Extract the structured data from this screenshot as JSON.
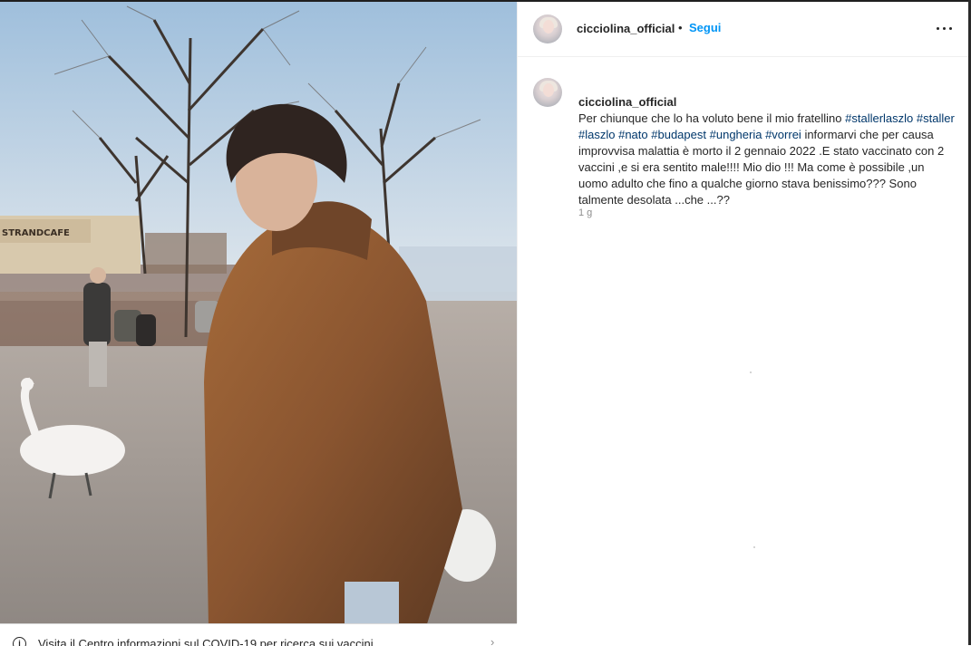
{
  "post": {
    "username": "cicciolina_official",
    "separator": "•",
    "follow_label": "Segui",
    "more_icon": "more-options-icon",
    "photo_sign_text": "STRANDCAFE"
  },
  "caption": {
    "author": "cicciolina_official",
    "segments": [
      {
        "text": " Per chiunque che lo ha voluto bene il mio fratellino ",
        "tag": false
      },
      {
        "text": "#stallerlaszlo",
        "tag": true
      },
      {
        "text": " ",
        "tag": false
      },
      {
        "text": "#staller",
        "tag": true
      },
      {
        "text": " ",
        "tag": false
      },
      {
        "text": "#laszlo",
        "tag": true
      },
      {
        "text": " ",
        "tag": false
      },
      {
        "text": "#nato",
        "tag": true
      },
      {
        "text": " ",
        "tag": false
      },
      {
        "text": "#budapest",
        "tag": true
      },
      {
        "text": " ",
        "tag": false
      },
      {
        "text": "#ungheria",
        "tag": true
      },
      {
        "text": " ",
        "tag": false
      },
      {
        "text": "#vorrei",
        "tag": true
      },
      {
        "text": " informarvi che per causa improvvisa malattia è morto il 2 gennaio 2022 .E stato vaccinato con 2 vaccini ,e si era sentito male!!!! Mio dio !!! Ma come è possibile ,un uomo adulto che fino a qualche giorno stava benissimo??? Sono talmente desolata ...che ...??",
        "tag": false
      }
    ],
    "time": "1 g"
  },
  "banner": {
    "text": "Visita il Centro informazioni sul COVID-19 per ricerca sui vaccini.",
    "icon": "info-icon"
  },
  "colors": {
    "link_blue": "#0095f6",
    "hashtag": "#00376b",
    "muted": "#8e8e8e",
    "border": "#efefef"
  }
}
